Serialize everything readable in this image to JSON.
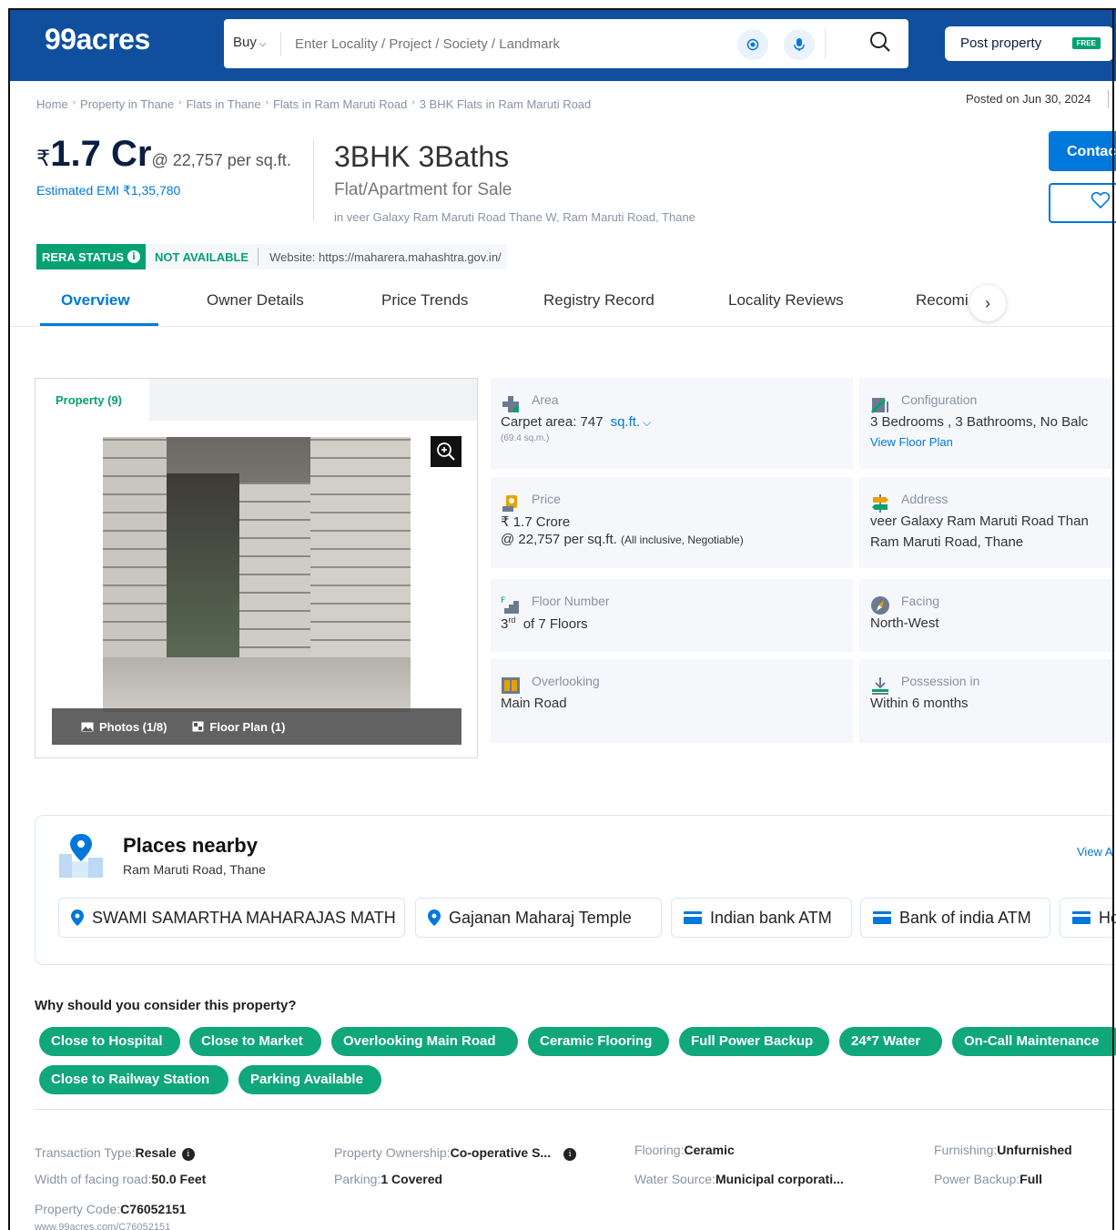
{
  "header": {
    "logo": "99acres",
    "buy_label": "Buy",
    "search_placeholder": "Enter Locality / Project / Society / Landmark",
    "post_property_label": "Post property",
    "free_badge": "FREE"
  },
  "breadcrumbs": [
    "Home",
    "Property in Thane",
    "Flats in Thane",
    "Flats in Ram Maruti Road",
    "3 BHK Flats in Ram Maruti Road"
  ],
  "posted": "Posted on Jun 30, 2024",
  "listing": {
    "currency": "₹",
    "price": "1.7 Cr",
    "price_per_sqft": "@ 22,757 per sq.ft.",
    "emi": "Estimated EMI ₹1,35,780",
    "title": "3BHK 3Baths",
    "subtitle": "Flat/Apartment for Sale",
    "location": "in veer Galaxy Ram Maruti Road Thane W, Ram Maruti Road, Thane",
    "contact_label": "Contac"
  },
  "rera": {
    "badge": "RERA STATUS",
    "status": "NOT AVAILABLE",
    "website": "Website: https://maharera.mahashtra.gov.in/"
  },
  "tabs": [
    "Overview",
    "Owner Details",
    "Price Trends",
    "Registry Record",
    "Locality Reviews",
    "Recomi"
  ],
  "gallery": {
    "tab_label": "Property (9)",
    "photos_label": "Photos (1/8)",
    "floorplan_label": "Floor Plan (1)"
  },
  "details": {
    "area": {
      "label": "Area",
      "value": "Carpet area: 747",
      "unit": "sq.ft.",
      "sub": "(69.4 sq.m.)"
    },
    "configuration": {
      "label": "Configuration",
      "value": "3 Bedrooms , 3 Bathrooms, No Balc",
      "link": "View Floor Plan"
    },
    "price": {
      "label": "Price",
      "value": "₹ 1.7 Crore",
      "value2": "@ 22,757 per sq.ft.",
      "note": "(All inclusive, Negotiable)"
    },
    "address": {
      "label": "Address",
      "value": "veer Galaxy Ram Maruti Road Than",
      "value2": "Ram Maruti Road, Thane"
    },
    "floor": {
      "label": "Floor Number",
      "value_num": "3",
      "value_sup": "rd",
      "value_rest": "of 7 Floors"
    },
    "facing": {
      "label": "Facing",
      "value": "North-West"
    },
    "overlooking": {
      "label": "Overlooking",
      "value": "Main Road"
    },
    "possession": {
      "label": "Possession in",
      "value": "Within 6 months"
    }
  },
  "places": {
    "title": "Places nearby",
    "subtitle": "Ram Maruti Road, Thane",
    "view_all": "View A",
    "items": [
      {
        "icon": "location-pin-icon",
        "name": "SWAMI SAMARTHA MAHARAJAS MATH"
      },
      {
        "icon": "location-pin-icon",
        "name": "Gajanan Maharaj Temple"
      },
      {
        "icon": "atm-icon",
        "name": "Indian bank ATM"
      },
      {
        "icon": "atm-icon",
        "name": "Bank of india ATM"
      },
      {
        "icon": "atm-icon",
        "name": "Ho"
      }
    ]
  },
  "why": {
    "title": "Why should you consider this property?",
    "tags": [
      "Close to Hospital",
      "Close to Market",
      "Overlooking Main Road",
      "Ceramic Flooring",
      "Full Power Backup",
      "24*7 Water",
      "On-Call Maintenance",
      "Close to Railway Station",
      "Parking Available"
    ]
  },
  "specs": {
    "transaction_type": {
      "label": "Transaction Type",
      "value": "Resale"
    },
    "width_road": {
      "label": "Width of facing road",
      "value": "50.0 Feet"
    },
    "property_code": {
      "label": "Property Code",
      "value": "C76052151"
    },
    "ownership": {
      "label": "Property Ownership",
      "value": "Co-operative S..."
    },
    "parking": {
      "label": "Parking",
      "value": "1 Covered"
    },
    "flooring": {
      "label": "Flooring",
      "value": "Ceramic"
    },
    "water": {
      "label": "Water Source",
      "value": "Municipal corporati..."
    },
    "furnishing": {
      "label": "Furnishing",
      "value": "Unfurnished"
    },
    "power": {
      "label": "Power Backup",
      "value": "Full"
    },
    "url": "www.99acres.com/C76052151"
  },
  "colors": {
    "header_blue": "#0f4f9e",
    "accent_blue": "#0078db",
    "green": "#04a173"
  }
}
